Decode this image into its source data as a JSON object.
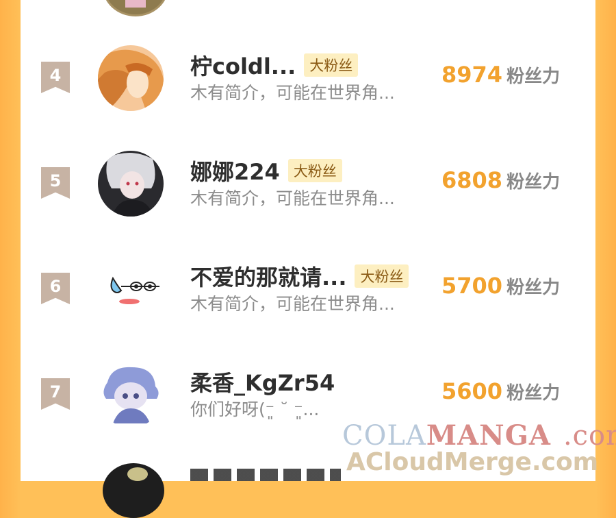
{
  "rows": [
    {
      "rank": "4",
      "name": "柠coldl...",
      "badge": "大粉丝",
      "bio": "木有简介，可能在世界角...",
      "score": "8974",
      "unit": "粉丝力"
    },
    {
      "rank": "5",
      "name": "娜娜224",
      "badge": "大粉丝",
      "bio": "木有简介，可能在世界角...",
      "score": "6808",
      "unit": "粉丝力"
    },
    {
      "rank": "6",
      "name": "不爱的那就请...",
      "badge": "大粉丝",
      "bio": "木有简介，可能在世界角...",
      "score": "5700",
      "unit": "粉丝力"
    },
    {
      "rank": "7",
      "name": "柔香_KgZr54",
      "badge": "",
      "bio": "你们好呀(⁻͈ ˘ ⁻͈...",
      "score": "5600",
      "unit": "粉丝力"
    }
  ],
  "watermark": {
    "part1": "COLA",
    "part2": "MANGA",
    "part3": ".com",
    "line2": "ACloudMerge.com"
  },
  "colors": {
    "accent": "#F2A22E",
    "badge_bg": "#FDEFC1",
    "rank_bg": "#C7B3A4",
    "frame": "#FFC058"
  }
}
